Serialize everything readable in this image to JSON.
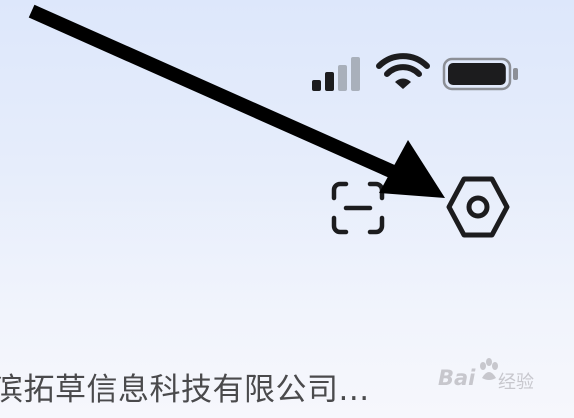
{
  "status_bar": {
    "signal_icon": "cellular-signal-icon",
    "signal_strength": 0.5,
    "wifi_icon": "wifi-icon",
    "battery_icon": "battery-icon",
    "battery_level": 0.9
  },
  "toolbar": {
    "scan_icon": "scan-icon",
    "settings_icon": "settings-hexagon-icon"
  },
  "annotation": {
    "arrow_icon": "annotation-arrow-icon",
    "arrow_color": "#000000"
  },
  "content": {
    "company_name": "滨拓草信息科技有限公司..."
  },
  "watermark": {
    "brand": "Bai",
    "suffix": "经验",
    "logo_icon": "baidu-paw-icon"
  },
  "colors": {
    "icon_stroke": "#1c1c1e",
    "signal_inactive": "#a9b0bb",
    "background_top": "#dde7fb",
    "background_bottom": "#f6f7fc",
    "text": "#4a4a4c"
  }
}
